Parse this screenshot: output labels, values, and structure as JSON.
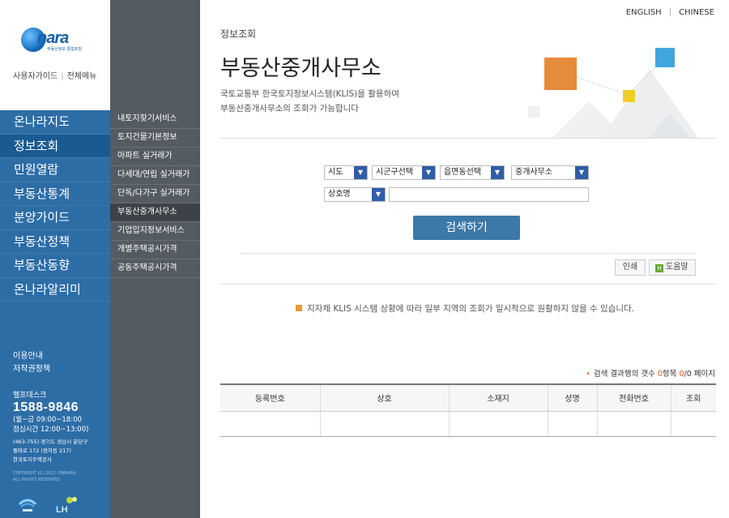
{
  "brand": {
    "logo_text": "nara",
    "logo_sub": "부동산정보 통합포털"
  },
  "util_links": [
    "사용자가이드",
    "전체메뉴"
  ],
  "main_nav": [
    "온나라지도",
    "정보조회",
    "민원열람",
    "부동산통계",
    "분양가이드",
    "부동산정책",
    "부동산동향",
    "온나라알리미"
  ],
  "main_nav_active": 1,
  "sub_nav": [
    "내토지찾기서비스",
    "토지건물기본정보",
    "아파트 실거래가",
    "다세대/연립 실거래가",
    "단독/다가구 실거래가",
    "부동산중개사무소",
    "기업입지정보서비스",
    "개별주택공시가격",
    "공동주택공시가격"
  ],
  "sub_nav_active": 5,
  "left_info": [
    "이용안내",
    "저작권정책"
  ],
  "helpdesk": {
    "label": "헬프데스크",
    "phone": "1588-9846",
    "hours1": "(월~금 09:00~18:00",
    "hours2": "점심시간 12:00~13:00)"
  },
  "address": [
    "(463-755) 경기도 성남시 분당구",
    "돌마로 172 (정자동 217)",
    "한국토지주택공사"
  ],
  "copyright": [
    "COPYRIGHT (C) 2012, ONNARA,",
    "ALL RIGHTS RESERVED."
  ],
  "lang": [
    "ENGLISH",
    "CHINESE"
  ],
  "breadcrumb": "정보조회",
  "page_title": "부동산중개사무소",
  "description": [
    "국토교통부 한국토지정보시스템(KLIS)을 활용하여",
    "부동산중개사무소의 조회가 가능합니다"
  ],
  "filters": {
    "sido": "시도",
    "sigungu": "시군구선택",
    "eupmyeondong": "읍면동선택",
    "office_type": "중개사무소",
    "search_type": "상호명",
    "keyword": ""
  },
  "search_button": "검색하기",
  "print_button": "인쇄",
  "help_button": "도움말",
  "notice": "지자체 KLIS 시스템 상황에 따라 일부 지역의 조회가 일시적으로 원활하지 않을 수 있습니다.",
  "result": {
    "prefix": "검색 결과행의 갯수",
    "count": "0",
    "unit": "항목",
    "page": "0",
    "sep": "/",
    "total": "0",
    "page_label": "페이지"
  },
  "table": {
    "headers": [
      "등록번호",
      "상호",
      "소재지",
      "성명",
      "전화번호",
      "조회"
    ],
    "rows": []
  },
  "colors": {
    "nav_blue": "#2d6da6",
    "subnav_gray": "#555b63",
    "button_blue": "#3c78a8",
    "accent_orange": "#e0561f"
  }
}
